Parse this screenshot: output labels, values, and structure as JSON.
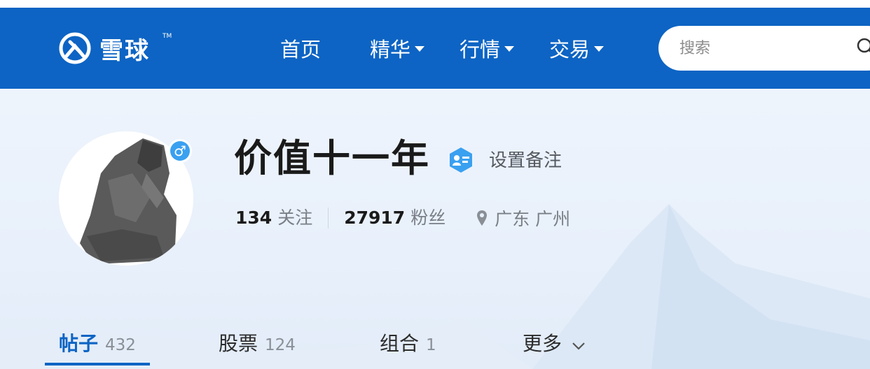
{
  "nav": {
    "logo_text": "雪球",
    "logo_tm": "TM",
    "items": [
      {
        "label": "首页",
        "has_dropdown": false
      },
      {
        "label": "精华",
        "has_dropdown": true
      },
      {
        "label": "行情",
        "has_dropdown": true
      },
      {
        "label": "交易",
        "has_dropdown": true
      }
    ],
    "search_placeholder": "搜索"
  },
  "profile": {
    "username": "价值十一年",
    "remark_label": "设置备注",
    "following_count": "134",
    "following_label": "关注",
    "followers_count": "27917",
    "followers_label": "粉丝",
    "location": "广东 广州",
    "gender_symbol": "♂"
  },
  "tabs": [
    {
      "label": "帖子",
      "count": "432",
      "active": true
    },
    {
      "label": "股票",
      "count": "124",
      "active": false
    },
    {
      "label": "组合",
      "count": "1",
      "active": false
    },
    {
      "label": "更多",
      "count": "",
      "active": false
    }
  ],
  "colors": {
    "brand_blue": "#0d64c4",
    "badge_blue": "#3aa0f0",
    "hero_bg": "#eef4fc"
  },
  "icons": [
    "xueqiu-logo-icon",
    "search-icon",
    "male-gender-icon",
    "verified-badge-icon",
    "location-pin-icon",
    "chevron-down-icon"
  ]
}
